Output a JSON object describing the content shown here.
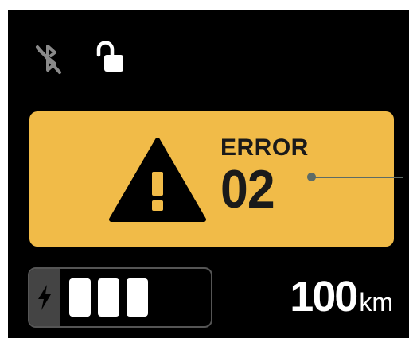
{
  "status_bar": {
    "bluetooth_icon": "bluetooth-disabled-icon",
    "lock_icon": "unlocked-icon"
  },
  "alert": {
    "label": "ERROR",
    "code": "02",
    "icon": "warning-icon",
    "background_color": "#F1BB48"
  },
  "battery": {
    "icon": "charging-bolt-icon",
    "filled_segments": 3
  },
  "range": {
    "value": "100",
    "unit": "km"
  }
}
